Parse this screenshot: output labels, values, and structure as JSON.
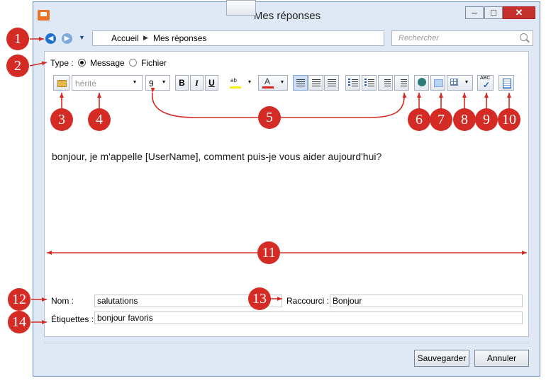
{
  "window": {
    "title": "Mes réponses",
    "minimize": "–",
    "maximize": "□",
    "close": "✕"
  },
  "nav": {
    "back": "◀",
    "forward": "▶",
    "dropdown": "▼"
  },
  "breadcrumb": {
    "home": "Accueil",
    "separator": "▶",
    "current": "Mes réponses"
  },
  "search": {
    "placeholder": "Rechercher"
  },
  "type": {
    "label": "Type :",
    "options": [
      "Message",
      "Fichier"
    ],
    "selected": "Message"
  },
  "toolbar": {
    "font": "hérité",
    "size": "9",
    "bold": "B",
    "italic": "I",
    "underline": "U",
    "highlight_glyph": "ab",
    "font_color_glyph": "A",
    "dropdown": "▾",
    "spellcheck_glyph": "ABC",
    "check_glyph": "✓",
    "highlight_color": "#f5ef1c",
    "font_color": "#d9231c"
  },
  "editor": {
    "content": "bonjour, je m'appelle [UserName], comment puis-je vous aider aujourd'hui?"
  },
  "fields": {
    "nom_label": "Nom :",
    "nom_value": "salutations",
    "raccourci_label": "Raccourci :",
    "raccourci_value": "Bonjour",
    "etiquettes_label": "Étiquettes :",
    "etiquettes_value": "bonjour favoris"
  },
  "buttons": {
    "save": "Sauvegarder",
    "cancel": "Annuler"
  },
  "callouts": [
    "1",
    "2",
    "3",
    "4",
    "5",
    "6",
    "7",
    "8",
    "9",
    "10",
    "11",
    "12",
    "13",
    "14"
  ],
  "colors": {
    "callout": "#d52b25",
    "accent": "#1e6fcf",
    "window_bg": "#dfe8f5"
  }
}
